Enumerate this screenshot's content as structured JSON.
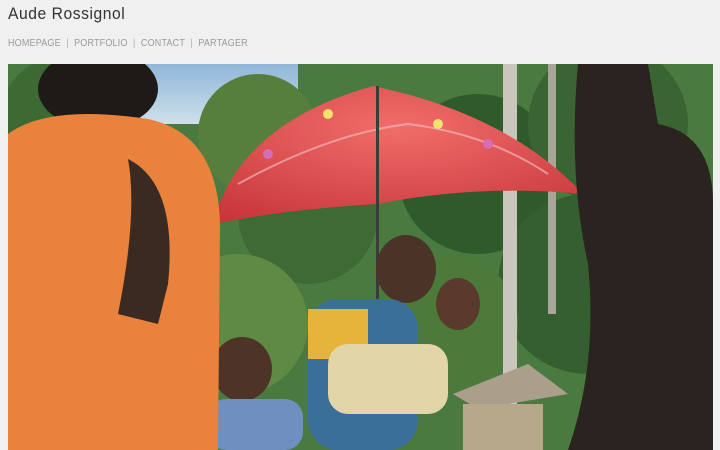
{
  "site": {
    "title": "Aude Rossignol"
  },
  "nav": {
    "items": [
      {
        "label": "HOMEPAGE"
      },
      {
        "label": "PORTFOLIO"
      },
      {
        "label": "CONTACT"
      },
      {
        "label": "PARTAGER"
      }
    ],
    "separator": "|"
  },
  "photo": {
    "colors": {
      "umbrella": "#e0494a",
      "shirt": "#e8823c",
      "sky": "#8fb6d8",
      "foliage": "#3f6a36"
    }
  }
}
